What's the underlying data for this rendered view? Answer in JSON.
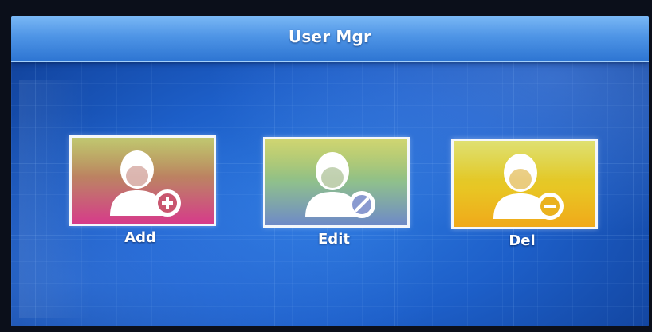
{
  "header": {
    "title": "User Mgr"
  },
  "menu": {
    "items": [
      {
        "label": "Add",
        "icon": "user-add-icon",
        "badge_icon": "plus-icon"
      },
      {
        "label": "Edit",
        "icon": "user-edit-icon",
        "badge_icon": "pencil-icon"
      },
      {
        "label": "Del",
        "icon": "user-delete-icon",
        "badge_icon": "minus-icon"
      }
    ]
  },
  "colors": {
    "background": "#1d5fc9",
    "title_bar": "#4f95e6",
    "add_tile": "#d63b8a",
    "edit_tile": "#8fc08d",
    "del_tile": "#e8c624",
    "text": "#ffffff"
  }
}
